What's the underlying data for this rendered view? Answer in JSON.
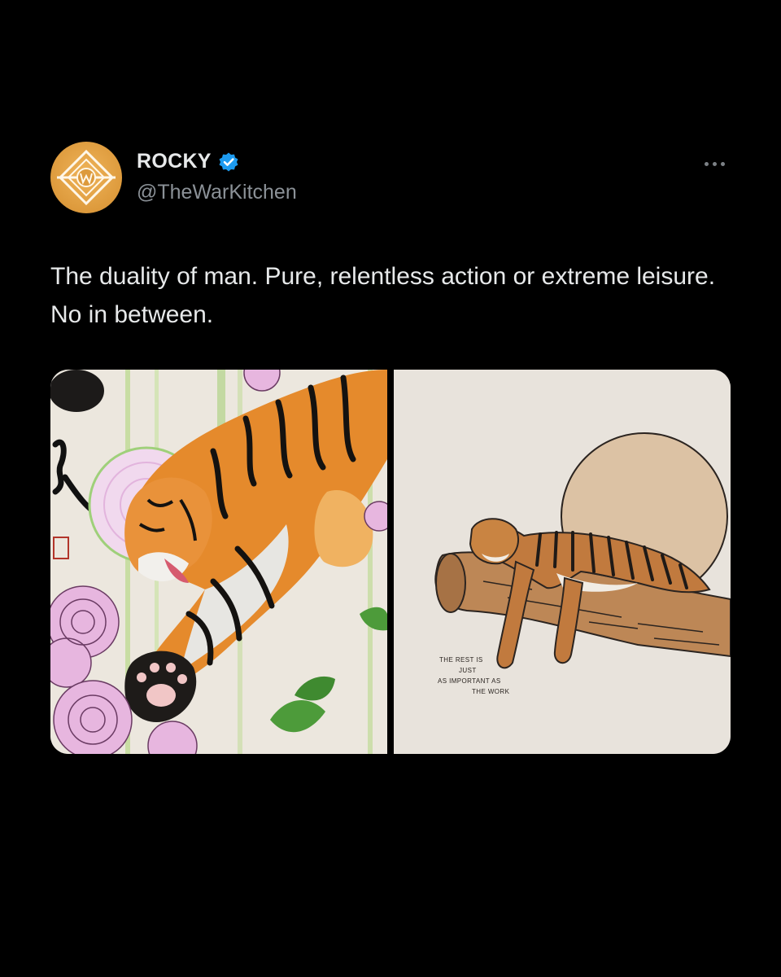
{
  "tweet": {
    "display_name": "ROCKY",
    "handle": "@TheWarKitchen",
    "verified": true,
    "text": "The duality of man. Pure, relentless action or extreme leisure. No in between.",
    "avatar_icon": "war-kitchen-logo",
    "more_icon": "more-dots-icon",
    "media": [
      {
        "description_icon": "leaping-tiger-painting"
      },
      {
        "description_icon": "resting-tiger-illustration",
        "caption_lines": [
          "THE REST IS",
          "JUST",
          "AS IMPORTANT AS",
          "THE WORK"
        ]
      }
    ]
  },
  "colors": {
    "background": "#000000",
    "text": "#e7e9ea",
    "secondary_text": "#8b9197",
    "verified_blue": "#1d9bf0",
    "avatar_gold": "#dd9a3c"
  }
}
